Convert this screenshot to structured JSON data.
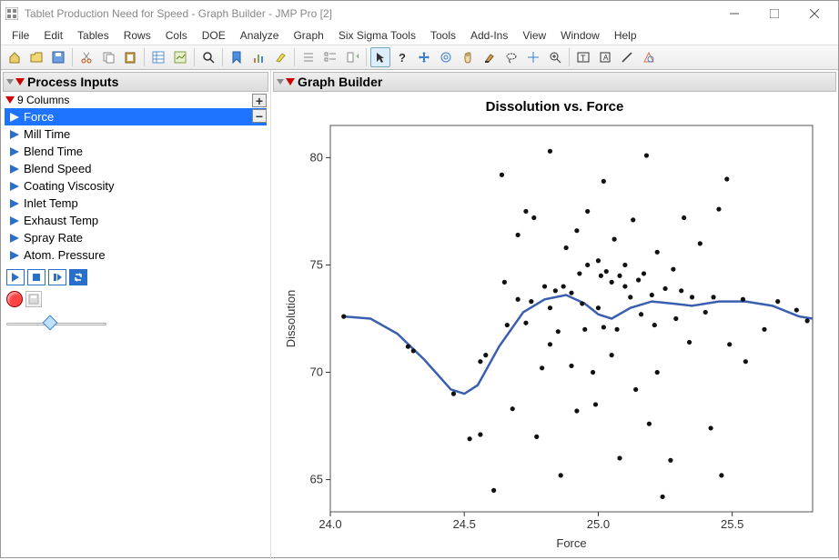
{
  "window": {
    "title": "Tablet Production Need for Speed - Graph Builder - JMP Pro [2]"
  },
  "menu": [
    "File",
    "Edit",
    "Tables",
    "Rows",
    "Cols",
    "DOE",
    "Analyze",
    "Graph",
    "Six Sigma Tools",
    "Tools",
    "Add-Ins",
    "View",
    "Window",
    "Help"
  ],
  "sidebar": {
    "title": "Process Inputs",
    "subtitle": "9 Columns",
    "columns": [
      {
        "label": "Force",
        "selected": true
      },
      {
        "label": "Mill Time",
        "selected": false
      },
      {
        "label": "Blend Time",
        "selected": false
      },
      {
        "label": "Blend Speed",
        "selected": false
      },
      {
        "label": "Coating Viscosity",
        "selected": false
      },
      {
        "label": "Inlet Temp",
        "selected": false
      },
      {
        "label": "Exhaust Temp",
        "selected": false
      },
      {
        "label": "Spray Rate",
        "selected": false
      },
      {
        "label": "Atom. Pressure",
        "selected": false
      }
    ]
  },
  "graph": {
    "panel_title": "Graph Builder",
    "title": "Dissolution vs. Force",
    "xlabel": "Force",
    "ylabel": "Dissolution"
  },
  "chart_data": {
    "type": "scatter",
    "xlabel": "Force",
    "ylabel": "Dissolution",
    "title": "Dissolution vs. Force",
    "xlim": [
      24.0,
      25.8
    ],
    "ylim": [
      63.5,
      81.5
    ],
    "xticks": [
      24.0,
      24.5,
      25.0,
      25.5
    ],
    "yticks": [
      65,
      70,
      75,
      80
    ],
    "smooth_line": [
      {
        "x": 24.05,
        "y": 72.6
      },
      {
        "x": 24.15,
        "y": 72.5
      },
      {
        "x": 24.25,
        "y": 71.8
      },
      {
        "x": 24.35,
        "y": 70.6
      },
      {
        "x": 24.45,
        "y": 69.2
      },
      {
        "x": 24.5,
        "y": 69.0
      },
      {
        "x": 24.55,
        "y": 69.4
      },
      {
        "x": 24.63,
        "y": 71.2
      },
      {
        "x": 24.72,
        "y": 72.8
      },
      {
        "x": 24.8,
        "y": 73.4
      },
      {
        "x": 24.88,
        "y": 73.6
      },
      {
        "x": 24.95,
        "y": 73.2
      },
      {
        "x": 25.0,
        "y": 72.7
      },
      {
        "x": 25.05,
        "y": 72.5
      },
      {
        "x": 25.12,
        "y": 73.0
      },
      {
        "x": 25.2,
        "y": 73.3
      },
      {
        "x": 25.28,
        "y": 73.2
      },
      {
        "x": 25.35,
        "y": 73.1
      },
      {
        "x": 25.45,
        "y": 73.3
      },
      {
        "x": 25.55,
        "y": 73.3
      },
      {
        "x": 25.65,
        "y": 73.1
      },
      {
        "x": 25.75,
        "y": 72.6
      },
      {
        "x": 25.8,
        "y": 72.5
      }
    ],
    "points": [
      {
        "x": 24.05,
        "y": 72.6
      },
      {
        "x": 24.29,
        "y": 71.2
      },
      {
        "x": 24.31,
        "y": 71.0
      },
      {
        "x": 24.46,
        "y": 69.0
      },
      {
        "x": 24.52,
        "y": 66.9
      },
      {
        "x": 24.56,
        "y": 70.5
      },
      {
        "x": 24.56,
        "y": 67.1
      },
      {
        "x": 24.58,
        "y": 70.8
      },
      {
        "x": 24.61,
        "y": 64.5
      },
      {
        "x": 24.64,
        "y": 79.2
      },
      {
        "x": 24.65,
        "y": 74.2
      },
      {
        "x": 24.66,
        "y": 72.2
      },
      {
        "x": 24.68,
        "y": 68.3
      },
      {
        "x": 24.7,
        "y": 76.4
      },
      {
        "x": 24.7,
        "y": 73.4
      },
      {
        "x": 24.73,
        "y": 72.3
      },
      {
        "x": 24.73,
        "y": 77.5
      },
      {
        "x": 24.75,
        "y": 73.3
      },
      {
        "x": 24.76,
        "y": 77.2
      },
      {
        "x": 24.77,
        "y": 67.0
      },
      {
        "x": 24.79,
        "y": 70.2
      },
      {
        "x": 24.8,
        "y": 74.0
      },
      {
        "x": 24.82,
        "y": 71.3
      },
      {
        "x": 24.82,
        "y": 73.0
      },
      {
        "x": 24.82,
        "y": 80.3
      },
      {
        "x": 24.84,
        "y": 73.8
      },
      {
        "x": 24.85,
        "y": 71.9
      },
      {
        "x": 24.86,
        "y": 65.2
      },
      {
        "x": 24.87,
        "y": 74.0
      },
      {
        "x": 24.88,
        "y": 75.8
      },
      {
        "x": 24.9,
        "y": 70.3
      },
      {
        "x": 24.9,
        "y": 73.7
      },
      {
        "x": 24.92,
        "y": 76.6
      },
      {
        "x": 24.92,
        "y": 68.2
      },
      {
        "x": 24.93,
        "y": 74.6
      },
      {
        "x": 24.94,
        "y": 73.2
      },
      {
        "x": 24.95,
        "y": 72.0
      },
      {
        "x": 24.96,
        "y": 75.0
      },
      {
        "x": 24.96,
        "y": 77.5
      },
      {
        "x": 24.98,
        "y": 70.0
      },
      {
        "x": 24.99,
        "y": 68.5
      },
      {
        "x": 25.0,
        "y": 75.2
      },
      {
        "x": 25.0,
        "y": 73.0
      },
      {
        "x": 25.01,
        "y": 74.5
      },
      {
        "x": 25.02,
        "y": 72.1
      },
      {
        "x": 25.02,
        "y": 78.9
      },
      {
        "x": 25.03,
        "y": 74.7
      },
      {
        "x": 25.05,
        "y": 70.8
      },
      {
        "x": 25.05,
        "y": 74.2
      },
      {
        "x": 25.06,
        "y": 76.2
      },
      {
        "x": 25.07,
        "y": 72.0
      },
      {
        "x": 25.08,
        "y": 74.5
      },
      {
        "x": 25.08,
        "y": 66.0
      },
      {
        "x": 25.1,
        "y": 74.0
      },
      {
        "x": 25.1,
        "y": 75.0
      },
      {
        "x": 25.12,
        "y": 73.5
      },
      {
        "x": 25.13,
        "y": 77.1
      },
      {
        "x": 25.14,
        "y": 69.2
      },
      {
        "x": 25.15,
        "y": 74.3
      },
      {
        "x": 25.16,
        "y": 72.7
      },
      {
        "x": 25.17,
        "y": 74.6
      },
      {
        "x": 25.18,
        "y": 80.1
      },
      {
        "x": 25.19,
        "y": 67.6
      },
      {
        "x": 25.2,
        "y": 73.6
      },
      {
        "x": 25.21,
        "y": 72.2
      },
      {
        "x": 25.22,
        "y": 70.0
      },
      {
        "x": 25.22,
        "y": 75.6
      },
      {
        "x": 25.24,
        "y": 64.2
      },
      {
        "x": 25.25,
        "y": 73.9
      },
      {
        "x": 25.27,
        "y": 65.9
      },
      {
        "x": 25.28,
        "y": 74.8
      },
      {
        "x": 25.29,
        "y": 72.5
      },
      {
        "x": 25.31,
        "y": 73.8
      },
      {
        "x": 25.32,
        "y": 77.2
      },
      {
        "x": 25.34,
        "y": 71.4
      },
      {
        "x": 25.35,
        "y": 73.5
      },
      {
        "x": 25.38,
        "y": 76.0
      },
      {
        "x": 25.4,
        "y": 72.8
      },
      {
        "x": 25.42,
        "y": 67.4
      },
      {
        "x": 25.43,
        "y": 73.5
      },
      {
        "x": 25.45,
        "y": 77.6
      },
      {
        "x": 25.46,
        "y": 65.2
      },
      {
        "x": 25.48,
        "y": 79.0
      },
      {
        "x": 25.49,
        "y": 71.3
      },
      {
        "x": 25.54,
        "y": 73.4
      },
      {
        "x": 25.55,
        "y": 70.5
      },
      {
        "x": 25.62,
        "y": 72.0
      },
      {
        "x": 25.67,
        "y": 73.3
      },
      {
        "x": 25.74,
        "y": 72.9
      },
      {
        "x": 25.78,
        "y": 72.4
      }
    ]
  }
}
